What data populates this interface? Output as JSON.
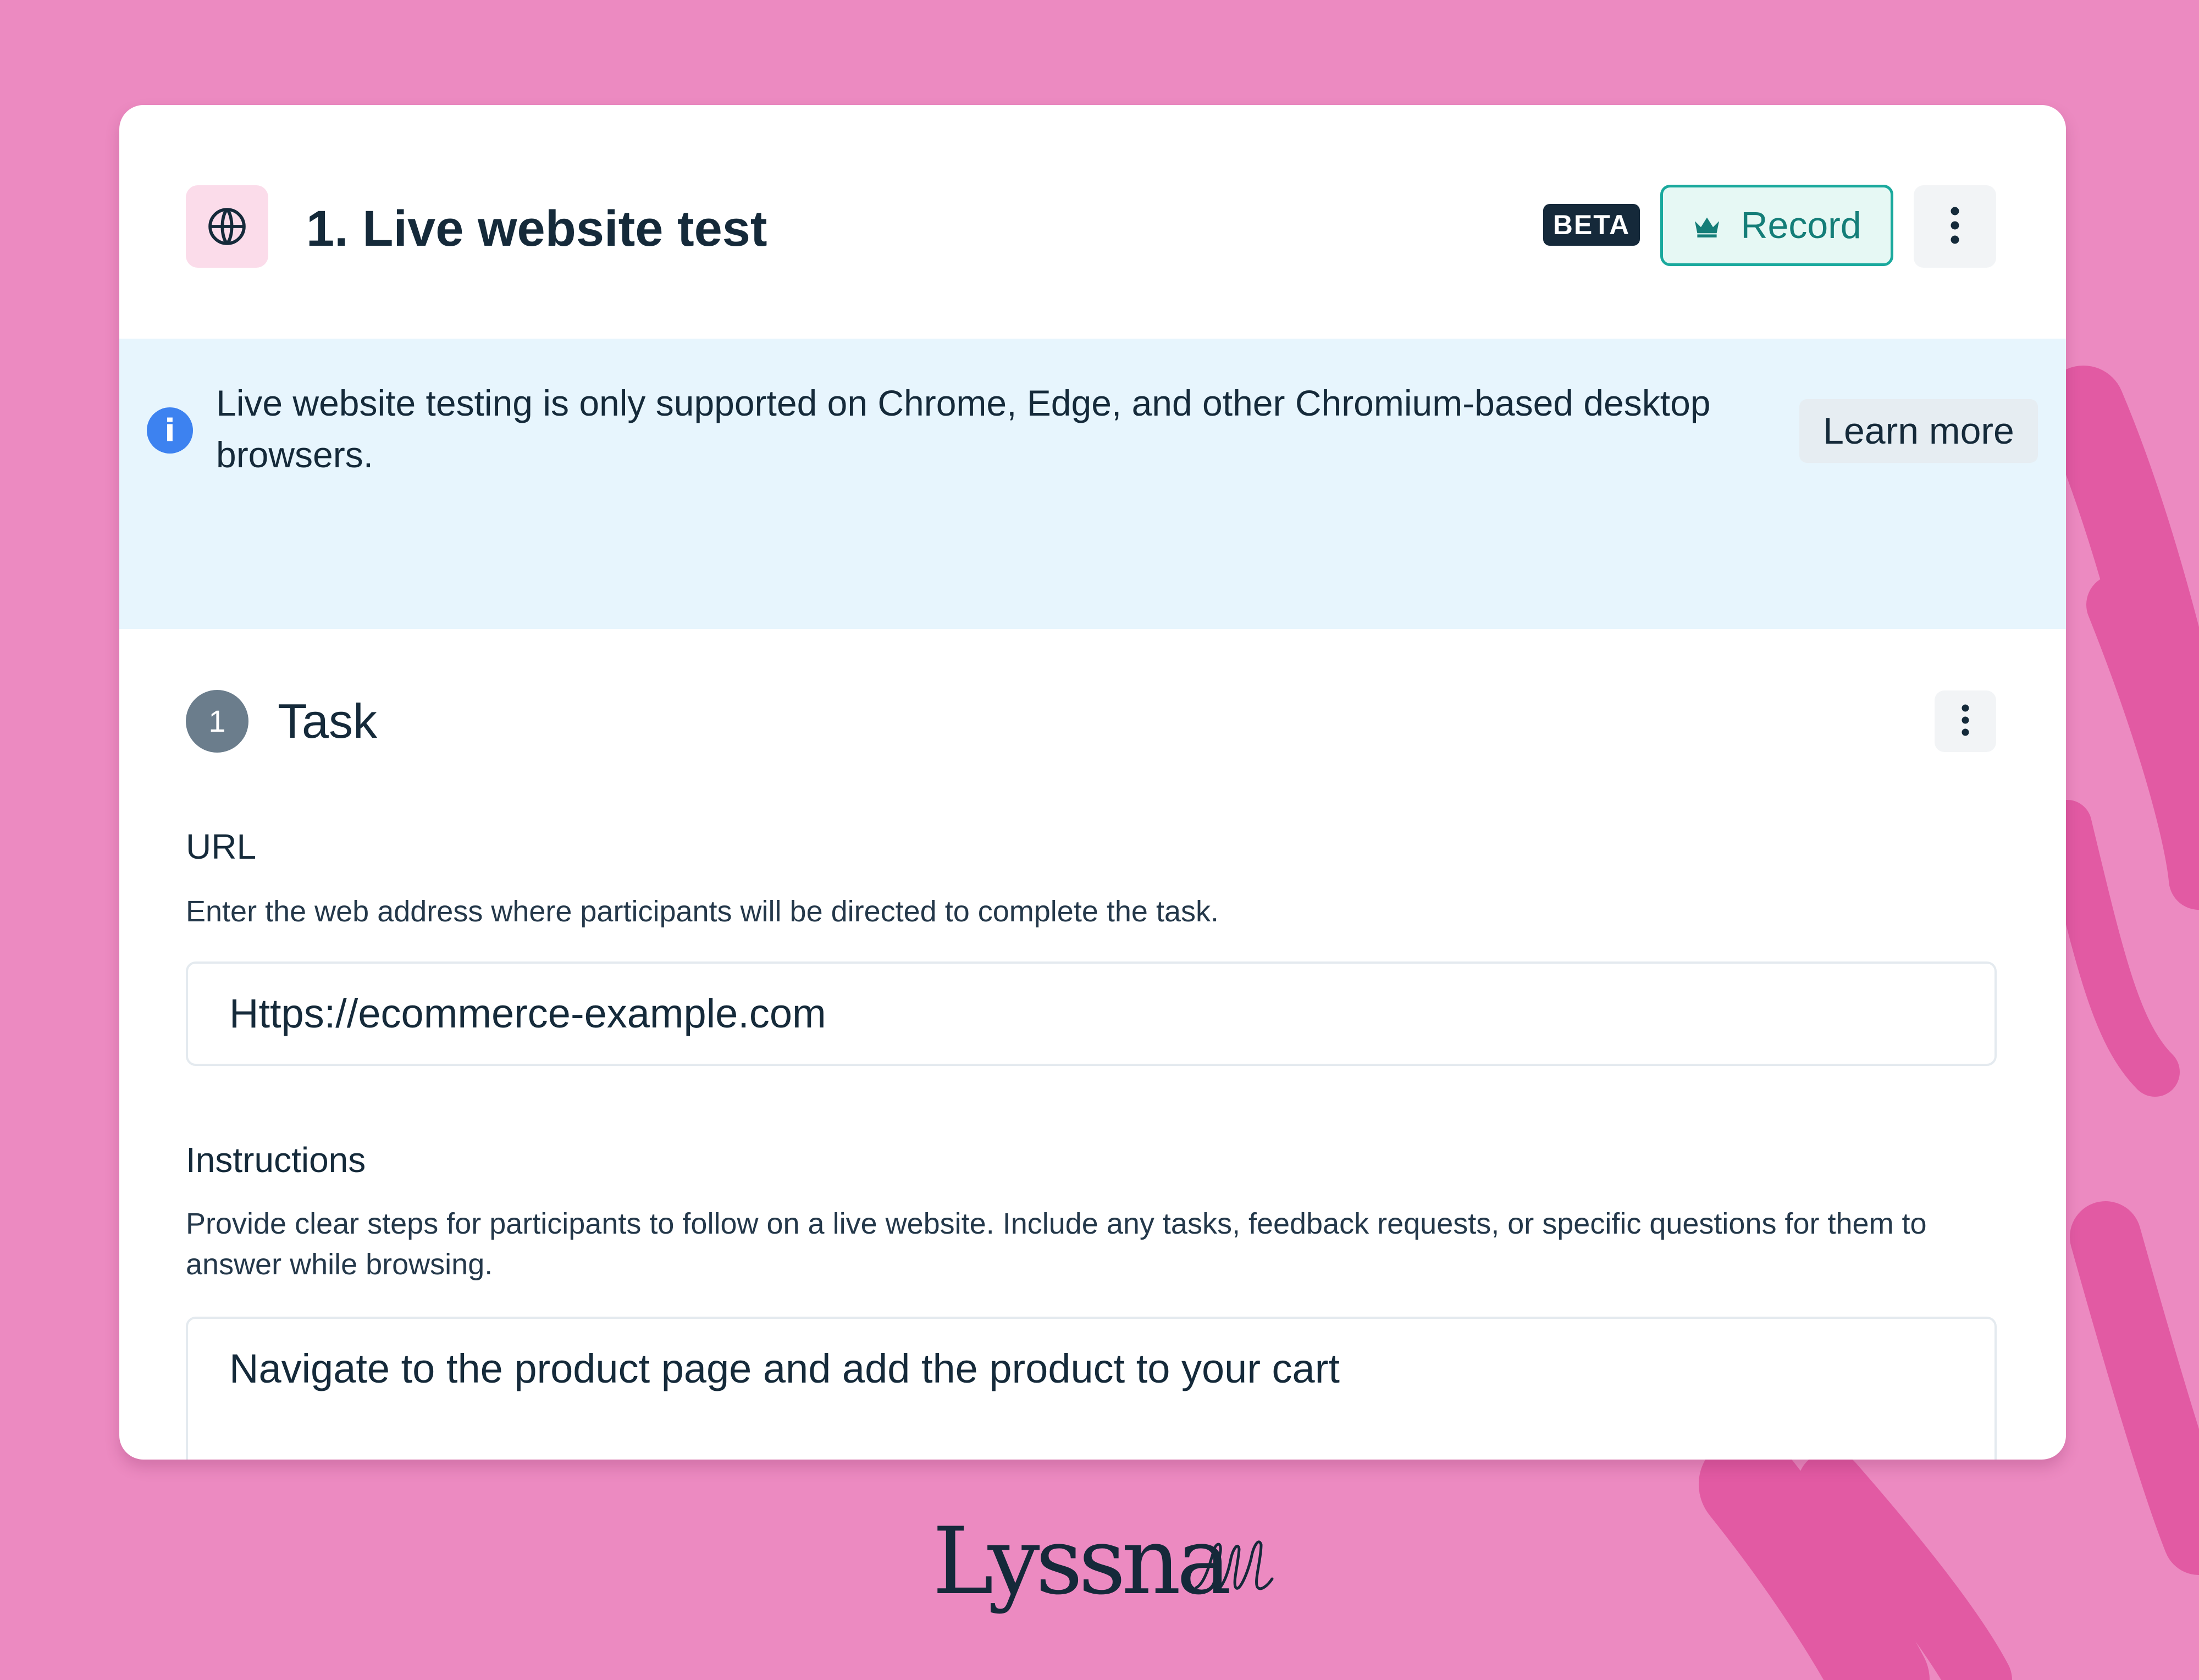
{
  "header": {
    "title": "1. Live website test",
    "badge": "BETA",
    "record_label": "Record",
    "icons": {
      "type": "globe-icon",
      "record": "crown-icon",
      "menu": "more-vertical-icon"
    }
  },
  "banner": {
    "message": "Live website testing is only supported on Chrome, Edge, and other Chromium-based desktop browsers.",
    "action": "Learn more",
    "icon": "info-icon"
  },
  "task": {
    "number": "1",
    "title": "Task",
    "url": {
      "label": "URL",
      "help": "Enter the web address where participants will be directed to complete the task.",
      "value": "Https://ecommerce-example.com"
    },
    "instructions": {
      "label": "Instructions",
      "help": "Provide clear steps for participants to follow on a live website. Include any tasks, feedback requests, or specific questions for them to answer while browsing.",
      "value": "Navigate to the product page and add the product to your cart"
    }
  },
  "brand": {
    "name": "Lyssna"
  },
  "colors": {
    "background": "#ec8ac1",
    "accent_teal": "#1aa99d",
    "info_blue": "#3d82f0",
    "banner_bg": "#e7f5fd",
    "text_dark": "#152a3a"
  }
}
